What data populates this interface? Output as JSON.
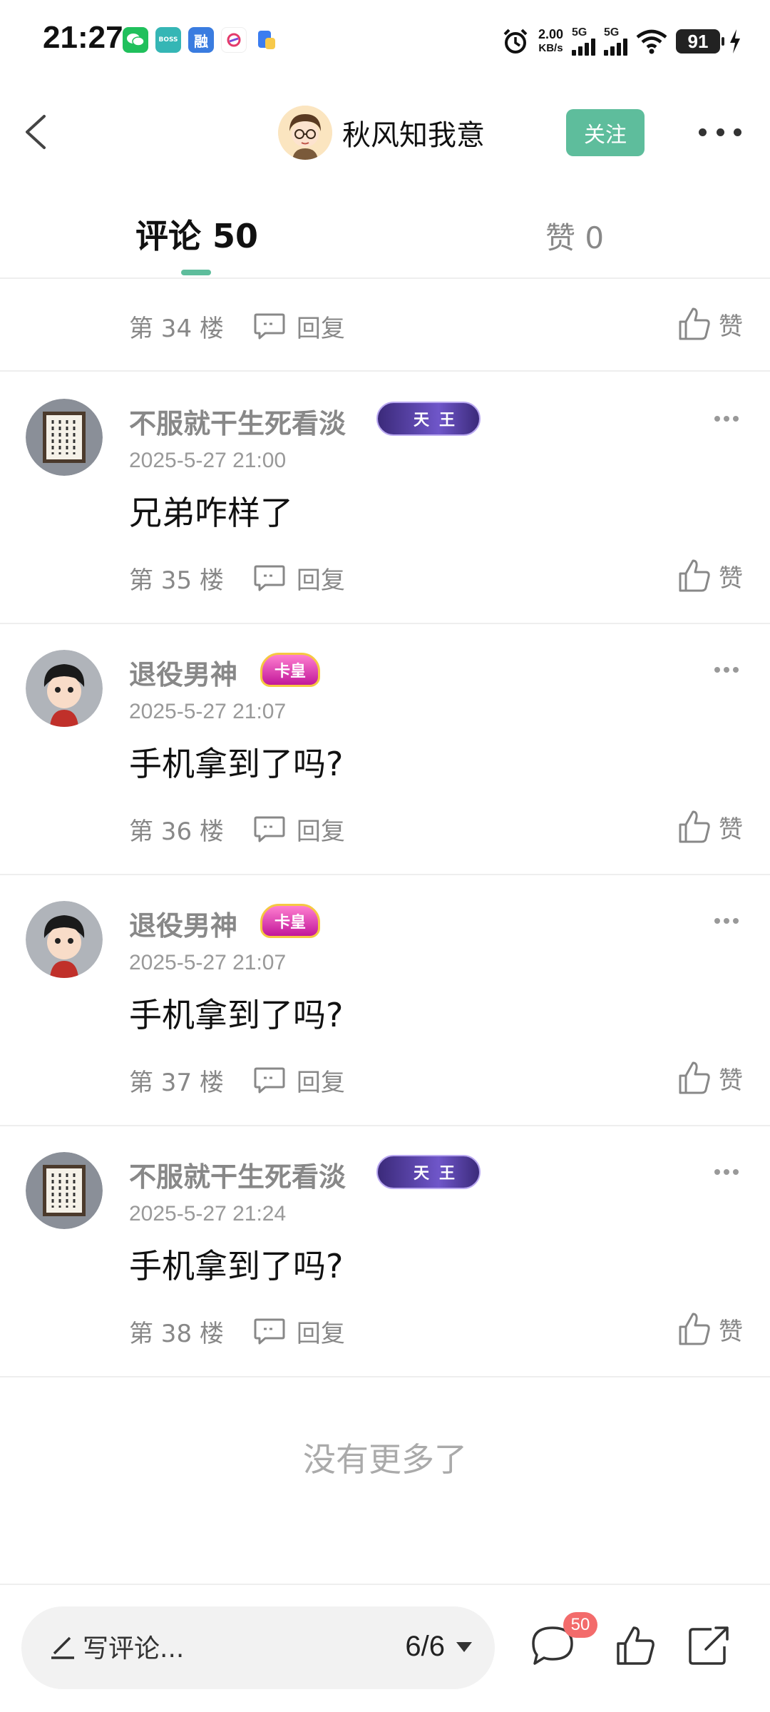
{
  "status_bar": {
    "time": "21:27",
    "apps": [
      "wechat-icon",
      "boss-zhipin-icon",
      "rong-icon",
      "app-icon",
      "file-icon"
    ],
    "app_labels": {
      "boss": "BOSS",
      "rong": "融"
    },
    "net_speed_value": "2.00",
    "net_speed_unit": "KB/s",
    "signal1": "5G",
    "signal2": "5G",
    "battery": "91"
  },
  "header": {
    "author_name": "秋风知我意",
    "follow_label": "关注"
  },
  "tabs": {
    "comments_label": "评论 50",
    "likes_label": "赞 0"
  },
  "partial": {
    "floor": "第 34 楼",
    "reply": "回复",
    "like": "赞"
  },
  "comments": [
    {
      "name": "不服就干生死看淡",
      "badge": "天王",
      "time": "2025-5-27 21:00",
      "text": "兄弟咋样了",
      "floor": "第 35 楼",
      "reply": "回复",
      "like": "赞"
    },
    {
      "name": "退役男神",
      "badge": "卡皇",
      "time": "2025-5-27 21:07",
      "text": "手机拿到了吗?",
      "floor": "第 36 楼",
      "reply": "回复",
      "like": "赞"
    },
    {
      "name": "退役男神",
      "badge": "卡皇",
      "time": "2025-5-27 21:07",
      "text": "手机拿到了吗?",
      "floor": "第 37 楼",
      "reply": "回复",
      "like": "赞"
    },
    {
      "name": "不服就干生死看淡",
      "badge": "天王",
      "time": "2025-5-27 21:24",
      "text": "手机拿到了吗?",
      "floor": "第 38 楼",
      "reply": "回复",
      "like": "赞"
    }
  ],
  "no_more": "没有更多了",
  "bottom": {
    "write_placeholder": "写评论...",
    "pager": "6/6",
    "comment_count": "50"
  },
  "colors": {
    "accent": "#5ebd9c",
    "badge_red": "#f36b6b"
  }
}
